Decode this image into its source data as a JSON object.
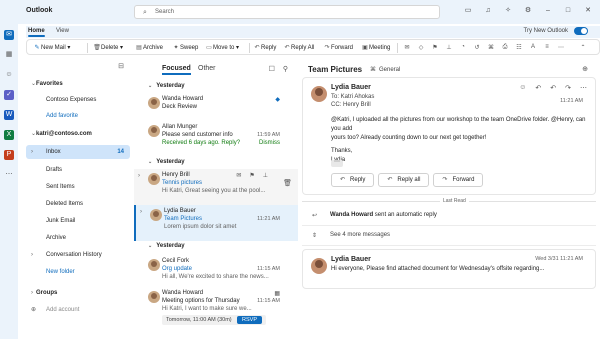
{
  "app": {
    "title": "Outlook"
  },
  "search": {
    "placeholder": "Search"
  },
  "ribbon_tabs": [
    {
      "label": "Home"
    },
    {
      "label": "View"
    }
  ],
  "try_new": {
    "label": "Try New Outlook"
  },
  "toolbar": {
    "new_mail": "New Mail",
    "delete": "Delete",
    "archive": "Archive",
    "sweep": "Sweep",
    "move_to": "Move to",
    "reply": "Reply",
    "reply_all": "Reply All",
    "forward": "Forward",
    "meeting": "Meeting"
  },
  "folders": {
    "favorites": "Favorites",
    "contoso_expenses": "Contoso Expenses",
    "add_favorite": "Add favorite",
    "account": "katri@contoso.com",
    "inbox": "Inbox",
    "inbox_count": "14",
    "drafts": "Drafts",
    "sent": "Sent Items",
    "deleted": "Deleted Items",
    "junk": "Junk Email",
    "archive": "Archive",
    "conversation_history": "Conversation History",
    "new_folder": "New folder",
    "groups": "Groups",
    "add_account": "Add account"
  },
  "list": {
    "tab_focused": "Focused",
    "tab_other": "Other",
    "groups": [
      "Yesterday",
      "Yesterday",
      "Yesterday"
    ],
    "items": [
      {
        "from": "Wanda Howard",
        "subject": "Deck Review",
        "preview": "",
        "time": ""
      },
      {
        "from": "Allan Munger",
        "subject": "Please send customer info",
        "preview": "Received 6 days ago. Reply?",
        "time": "11:59 AM",
        "extra": "Dismiss"
      },
      {
        "from": "Henry Brill",
        "subject": "Tennis pictures",
        "preview": "Hi Katri, Great seeing you at the pool...",
        "time": ""
      },
      {
        "from": "Lydia Bauer",
        "subject": "Team Pictures",
        "preview": "Lorem ipsum dolor sit amet",
        "time": "11:21 AM"
      },
      {
        "from": "Cecil Fork",
        "subject": "Org update",
        "preview": "Hi all, We're excited to share the news...",
        "time": "11:15 AM"
      },
      {
        "from": "Wanda Howard",
        "subject": "Meeting options for Thursday",
        "preview": "Hi Katri, I want to make sure we...",
        "time": "11:15 AM"
      }
    ],
    "tomorrow": "Tomorrow, 11:00 AM (30m)",
    "rsvp": "RSVP"
  },
  "reading": {
    "title": "Team Pictures",
    "channel": "General",
    "msg1": {
      "from": "Lydia Bauer",
      "to": "To: Katri Ahokas",
      "cc": "CC: Henry Brill",
      "time": "11:21 AM",
      "body1": "@Katri, I uploaded all the pictures from our workshop to the team OneDrive folder. @Henry, can you add",
      "body2": "yours too? Already counting down to our next get together!",
      "body3": "Thanks,",
      "body4": "Lydia"
    },
    "reply": "Reply",
    "reply_all": "Reply all",
    "forward": "Forward",
    "last_read": "Last Read",
    "auto_from": "Wanda Howard",
    "auto_text": "sent an automatic reply",
    "more_messages": "See 4 more messages",
    "msg2": {
      "from": "Lydia Bauer",
      "time": "Wed 3/31 11:21 AM",
      "body": "Hi everyone, Please find attached document for Wednesday's offsite regarding..."
    }
  }
}
